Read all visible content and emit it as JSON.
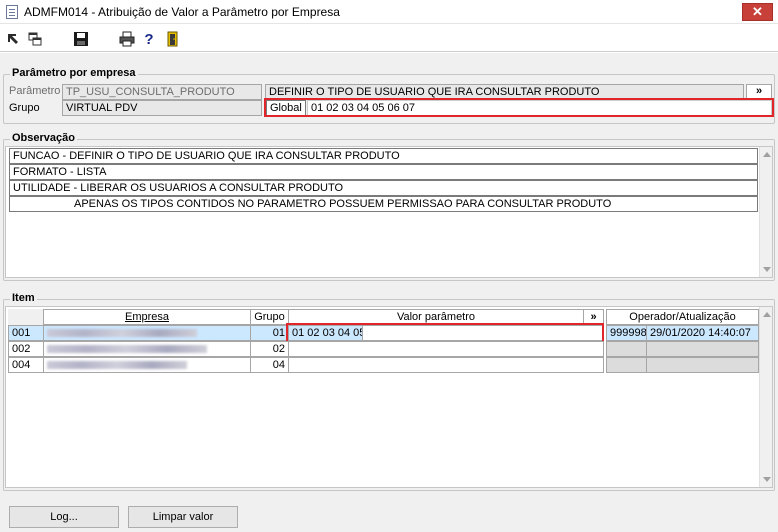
{
  "window": {
    "title": "ADMFM014 - Atribuição de Valor a Parâmetro por Empresa",
    "close_label": "✕"
  },
  "toolbar": {
    "icons": [
      "select-arrow-icon",
      "windows-icon",
      "save-icon",
      "print-icon",
      "help-icon",
      "exit-door-icon"
    ],
    "help_label": "?"
  },
  "parametro_empresa": {
    "legend": "Parâmetro por empresa",
    "parametro_label": "Parâmetro",
    "parametro_value": "TP_USU_CONSULTA_PRODUTO",
    "descricao_value": "DEFINIR O TIPO DE USUARIO QUE IRA CONSULTAR PRODUTO",
    "expand_label": "»",
    "grupo_label": "Grupo",
    "grupo_value": "VIRTUAL PDV",
    "global_label": "Global",
    "global_value": "01 02 03 04 05 06 07"
  },
  "observacao": {
    "legend": "Observação",
    "lines": [
      "FUNCAO - DEFINIR O TIPO DE USUARIO QUE IRA CONSULTAR PRODUTO",
      "FORMATO - LISTA",
      "UTILIDADE - LIBERAR OS USUARIOS A CONSULTAR PRODUTO",
      "APENAS OS TIPOS CONTIDOS NO PARAMETRO POSSUEM PERMISSAO PARA CONSULTAR PRODUTO"
    ]
  },
  "item": {
    "legend": "Item",
    "headers": {
      "empresa": "Empresa",
      "grupo": "Grupo",
      "valor": "Valor parâmetro",
      "expand": "»",
      "operador": "Operador/Atualização"
    },
    "rows": [
      {
        "code": "001",
        "grupo": "01",
        "valor": "01 02 03 04 05",
        "operador": "999998",
        "atualizacao": "29/01/2020 14:40:07"
      },
      {
        "code": "002",
        "grupo": "02",
        "valor": "",
        "operador": "",
        "atualizacao": ""
      },
      {
        "code": "004",
        "grupo": "04",
        "valor": "",
        "operador": "",
        "atualizacao": ""
      }
    ]
  },
  "buttons": {
    "log": "Log...",
    "limpar": "Limpar valor"
  }
}
